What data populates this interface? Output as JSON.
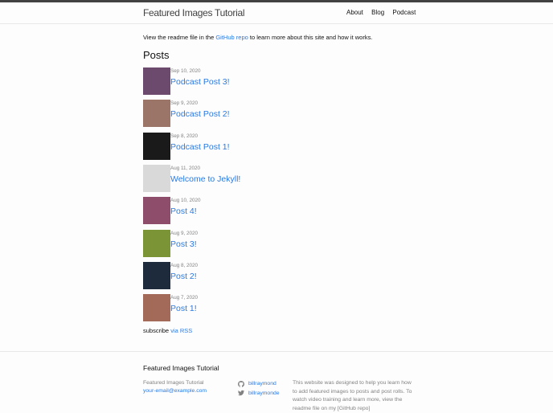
{
  "site": {
    "title": "Featured Images Tutorial"
  },
  "nav": [
    "About",
    "Blog",
    "Podcast"
  ],
  "intro": {
    "before": "View the readme file in the ",
    "link": "GitHub repo",
    "after": " to learn more about this site and how it works."
  },
  "posts_heading": "Posts",
  "posts": [
    {
      "date": "Sep 10, 2020",
      "title": "Podcast Post 3!",
      "thumb": "#6b4a6e"
    },
    {
      "date": "Sep 9, 2020",
      "title": "Podcast Post 2!",
      "thumb": "#9b7668"
    },
    {
      "date": "Sep 8, 2020",
      "title": "Podcast Post 1!",
      "thumb": "#1a1a1a"
    },
    {
      "date": "Aug 11, 2020",
      "title": "Welcome to Jekyll!",
      "thumb": "#d9d9d9"
    },
    {
      "date": "Aug 10, 2020",
      "title": "Post 4!",
      "thumb": "#8d4d6b"
    },
    {
      "date": "Aug 9, 2020",
      "title": "Post 3!",
      "thumb": "#7a9436"
    },
    {
      "date": "Aug 8, 2020",
      "title": "Post 2!",
      "thumb": "#1d2b3c"
    },
    {
      "date": "Aug 7, 2020",
      "title": "Post 1!",
      "thumb": "#a36a5a"
    }
  ],
  "subscribe": {
    "text": "subscribe ",
    "link": "via RSS"
  },
  "footer": {
    "title": "Featured Images Tutorial",
    "name": "Featured Images Tutorial",
    "email": "your-email@example.com",
    "github": "billraymond",
    "twitter": "billraymonde",
    "description": "This website was designed to help you learn how to add featured images to posts and post rolls. To watch video training and learn more, view the readme file on my [GitHub repo]"
  }
}
